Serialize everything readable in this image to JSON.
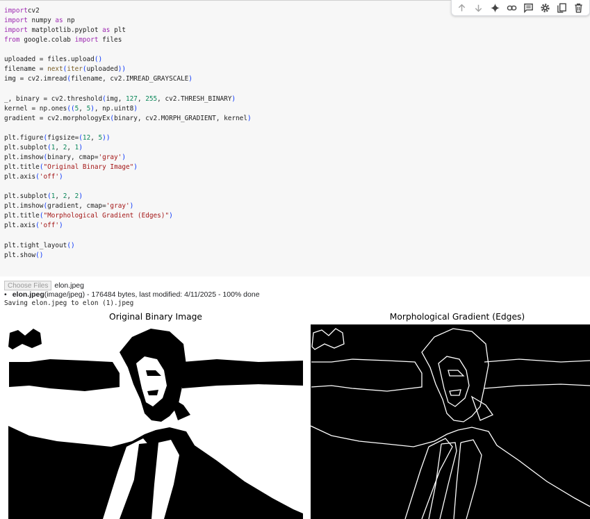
{
  "code_lines": [
    [
      [
        "kw",
        "import"
      ],
      [
        "",
        "cv2"
      ]
    ],
    [
      [
        "kw",
        "import"
      ],
      [
        "",
        " numpy "
      ],
      [
        "kw",
        "as"
      ],
      [
        "",
        " np"
      ]
    ],
    [
      [
        "kw",
        "import"
      ],
      [
        "",
        " matplotlib.pyplot "
      ],
      [
        "kw",
        "as"
      ],
      [
        "",
        " plt"
      ]
    ],
    [
      [
        "kw",
        "from"
      ],
      [
        "",
        " google.colab "
      ],
      [
        "kw",
        "import"
      ],
      [
        "",
        " files"
      ]
    ],
    [],
    [
      [
        "",
        "uploaded = files.upload"
      ],
      [
        "pn",
        "()"
      ]
    ],
    [
      [
        "",
        "filename = "
      ],
      [
        "fn",
        "next"
      ],
      [
        "pn",
        "("
      ],
      [
        "fn",
        "iter"
      ],
      [
        "pn",
        "("
      ],
      [
        "",
        "uploaded"
      ],
      [
        "pn",
        "))"
      ]
    ],
    [
      [
        "",
        "img = cv2.imread"
      ],
      [
        "pn",
        "("
      ],
      [
        "",
        "filename, cv2.IMREAD_GRAYSCALE"
      ],
      [
        "pn",
        ")"
      ]
    ],
    [],
    [
      [
        "",
        "_, binary = cv2.threshold"
      ],
      [
        "pn",
        "("
      ],
      [
        "",
        "img, "
      ],
      [
        "num",
        "127"
      ],
      [
        "",
        ", "
      ],
      [
        "num",
        "255"
      ],
      [
        "",
        ", cv2.THRESH_BINARY"
      ],
      [
        "pn",
        ")"
      ]
    ],
    [
      [
        "",
        "kernel = np.ones"
      ],
      [
        "pn",
        "(("
      ],
      [
        "num",
        "5"
      ],
      [
        "",
        ", "
      ],
      [
        "num",
        "5"
      ],
      [
        "pn",
        ")"
      ],
      [
        "",
        ", np.uint8"
      ],
      [
        "pn",
        ")"
      ]
    ],
    [
      [
        "",
        "gradient = cv2.morphologyEx"
      ],
      [
        "pn",
        "("
      ],
      [
        "",
        "binary, cv2.MORPH_GRADIENT, kernel"
      ],
      [
        "pn",
        ")"
      ]
    ],
    [],
    [
      [
        "",
        "plt.figure"
      ],
      [
        "pn",
        "("
      ],
      [
        "",
        "figsize="
      ],
      [
        "pn",
        "("
      ],
      [
        "num",
        "12"
      ],
      [
        "",
        ", "
      ],
      [
        "num",
        "5"
      ],
      [
        "pn",
        "))"
      ]
    ],
    [
      [
        "",
        "plt.subplot"
      ],
      [
        "pn",
        "("
      ],
      [
        "num",
        "1"
      ],
      [
        "",
        ", "
      ],
      [
        "num",
        "2"
      ],
      [
        "",
        ", "
      ],
      [
        "num",
        "1"
      ],
      [
        "pn",
        ")"
      ]
    ],
    [
      [
        "",
        "plt.imshow"
      ],
      [
        "pn",
        "("
      ],
      [
        "",
        "binary, cmap="
      ],
      [
        "str",
        "'gray'"
      ],
      [
        "pn",
        ")"
      ]
    ],
    [
      [
        "",
        "plt.title"
      ],
      [
        "pn",
        "("
      ],
      [
        "str",
        "\"Original Binary Image\""
      ],
      [
        "pn",
        ")"
      ]
    ],
    [
      [
        "",
        "plt.axis"
      ],
      [
        "pn",
        "("
      ],
      [
        "str",
        "'off'"
      ],
      [
        "pn",
        ")"
      ]
    ],
    [],
    [
      [
        "",
        "plt.subplot"
      ],
      [
        "pn",
        "("
      ],
      [
        "num",
        "1"
      ],
      [
        "",
        ", "
      ],
      [
        "num",
        "2"
      ],
      [
        "",
        ", "
      ],
      [
        "num",
        "2"
      ],
      [
        "pn",
        ")"
      ]
    ],
    [
      [
        "",
        "plt.imshow"
      ],
      [
        "pn",
        "("
      ],
      [
        "",
        "gradient, cmap="
      ],
      [
        "str",
        "'gray'"
      ],
      [
        "pn",
        ")"
      ]
    ],
    [
      [
        "",
        "plt.title"
      ],
      [
        "pn",
        "("
      ],
      [
        "str",
        "\"Morphological Gradient (Edges)\""
      ],
      [
        "pn",
        ")"
      ]
    ],
    [
      [
        "",
        "plt.axis"
      ],
      [
        "pn",
        "("
      ],
      [
        "str",
        "'off'"
      ],
      [
        "pn",
        ")"
      ]
    ],
    [],
    [
      [
        "",
        "plt.tight_layout"
      ],
      [
        "pn",
        "()"
      ]
    ],
    [
      [
        "",
        "plt.show"
      ],
      [
        "pn",
        "()"
      ]
    ]
  ],
  "toolbar": {
    "icons": [
      "arrow-up-icon",
      "arrow-down-icon",
      "sparkle-icon",
      "link-icon",
      "comment-icon",
      "gear-icon",
      "mirror-cell-icon",
      "trash-icon"
    ]
  },
  "output": {
    "choose_label": "Choose Files",
    "chosen_file": "elon.jpeg",
    "bullet": "•",
    "file_name": "elon.jpeg",
    "file_detail": "(image/jpeg) - 176484 bytes, last modified: 4/11/2025 - 100% done",
    "saving_text": "Saving elon.jpeg to elon (1).jpeg"
  },
  "figure": {
    "left_title": "Original Binary Image",
    "right_title": "Morphological Gradient (Edges)"
  },
  "colors": {
    "keyword": "#9c27b0",
    "string": "#a31515",
    "number": "#098658",
    "paren": "#0431fa",
    "builtin": "#795e26"
  }
}
